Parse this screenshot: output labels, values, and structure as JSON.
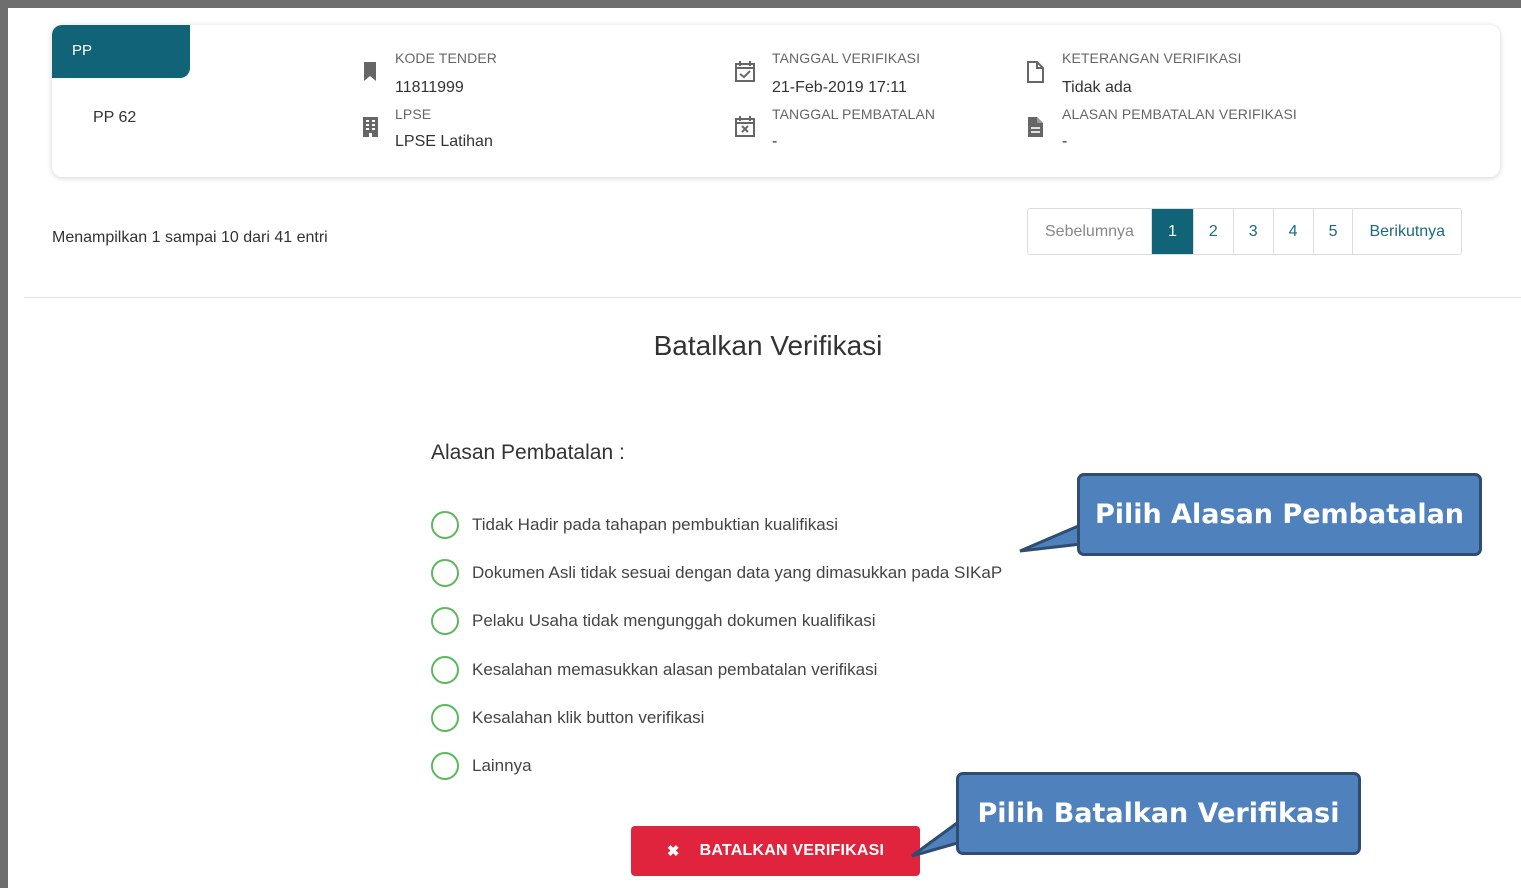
{
  "card": {
    "tab_label": "PP",
    "pp_value": "PP 62",
    "kode_tender_label": "KODE TENDER",
    "kode_tender_value": "11811999",
    "lpse_label": "LPSE",
    "lpse_value": "LPSE Latihan",
    "tanggal_verifikasi_label": "TANGGAL VERIFIKASI",
    "tanggal_verifikasi_value": "21-Feb-2019 17:11",
    "tanggal_pembatalan_label": "TANGGAL PEMBATALAN",
    "tanggal_pembatalan_value": "-",
    "keterangan_label": "KETERANGAN VERIFIKASI",
    "keterangan_value": "Tidak ada",
    "alasan_label": "ALASAN PEMBATALAN VERIFIKASI",
    "alasan_value": "-"
  },
  "table_info": "Menampilkan 1 sampai 10 dari 41 entri",
  "pagination": {
    "prev": "Sebelumnya",
    "pages": [
      "1",
      "2",
      "3",
      "4",
      "5"
    ],
    "active": "1",
    "next": "Berikutnya"
  },
  "modal": {
    "title": "Batalkan Verifikasi",
    "reason_heading": "Alasan Pembatalan :",
    "options": [
      "Tidak Hadir pada tahapan pembuktian kualifikasi",
      "Dokumen Asli tidak sesuai dengan data yang dimasukkan pada SIKaP",
      "Pelaku Usaha tidak mengunggah dokumen kualifikasi",
      "Kesalahan memasukkan alasan pembatalan verifikasi",
      "Kesalahan klik button verifikasi",
      "Lainnya"
    ],
    "cancel_button": "BATALKAN VERIFIKASI",
    "cancel_icon": "close-icon"
  },
  "callouts": {
    "pilih_alasan": "Pilih Alasan Pembatalan",
    "pilih_batalkan": "Pilih Batalkan Verifikasi"
  },
  "colors": {
    "primary": "#116478",
    "danger": "#e0243d",
    "radio": "#5cb85c",
    "callout": "#4f81bd"
  }
}
